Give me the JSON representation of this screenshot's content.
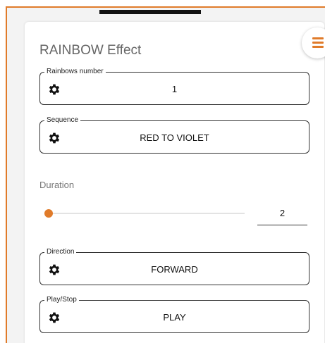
{
  "panel": {
    "title": "RAINBOW Effect"
  },
  "menu": {
    "icon": "hamburger-menu-icon",
    "color": "#e07b2a"
  },
  "fields": {
    "rainbows_number": {
      "label": "Rainbows number",
      "value": "1",
      "icon": "gear-icon"
    },
    "sequence": {
      "label": "Sequence",
      "value": "RED TO VIOLET",
      "icon": "gear-icon"
    },
    "direction": {
      "label": "Direction",
      "value": "FORWARD",
      "icon": "gear-icon"
    },
    "play_stop": {
      "label": "Play/Stop",
      "value": "PLAY",
      "icon": "gear-icon"
    }
  },
  "duration": {
    "label": "Duration",
    "value": "2",
    "slider_fraction": 0.0
  },
  "colors": {
    "accent": "#e07b2a"
  }
}
